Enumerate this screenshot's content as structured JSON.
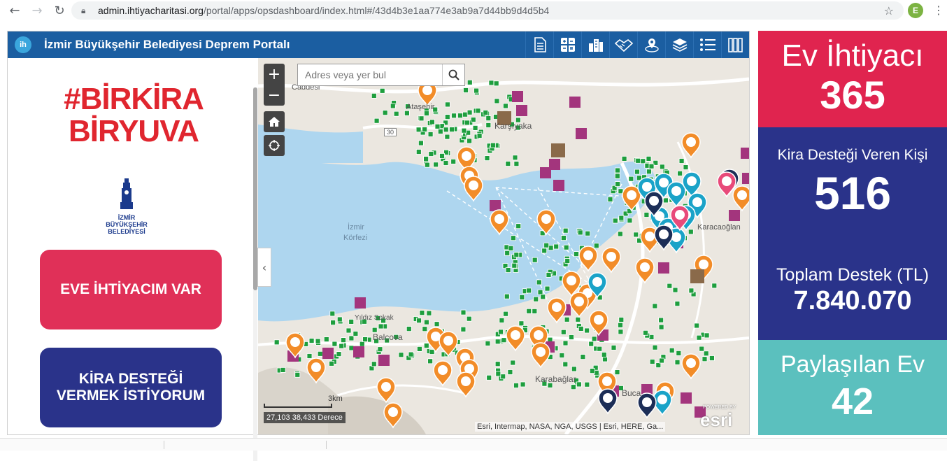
{
  "browser": {
    "url_domain": "admin.ihtiyacharitasi.org",
    "url_path": "/portal/apps/opsdashboard/index.html#/43d4b3e1aa774e3ab9a7d44bb9d4d5b4",
    "profile_initial": "E"
  },
  "header": {
    "logo_text": "ih",
    "title": "İzmir Büyükşehir Belediyesi Deprem Portalı"
  },
  "left_panel": {
    "campaign_line1": "#BİRKİRA",
    "campaign_line2": "BİRYUVA",
    "ibb_line1": "İZMİR",
    "ibb_line2": "BÜYÜKŞEHİR",
    "ibb_line3": "BELEDİYESİ",
    "cta_need_home": "EVE İHTİYACIM VAR",
    "cta_give_support": "KİRA DESTEĞİ VERMEK İSTİYORUM"
  },
  "map": {
    "search_placeholder": "Adres veya yer bul",
    "zoom_in": "+",
    "zoom_out": "−",
    "labels": {
      "karsiyaka": "Karşıyaka",
      "atasehir": "Ataşehir",
      "izmir_korfezi_1": "İzmir",
      "izmir_korfezi_2": "Körfezi",
      "karacaoglan": "Karacaoğlan",
      "yildiz_sokak": "Yıldız Sokak",
      "balcova": "Balçova",
      "karabaglar": "Karabağlar",
      "buca": "Buca",
      "caddesi": "Caddesi",
      "road_30": "30"
    },
    "scale_label": "3km",
    "coordinates": "27,103 38,433 Derece",
    "attribution": "Esri, Intermap, NASA, NGA, USGS | Esri, HERE, Ga...",
    "esri_logo": "esri",
    "esri_powered": "POWERED BY"
  },
  "stats": {
    "need_home_title": "Ev İhtiyacı",
    "need_home_value": "365",
    "rent_support_title": "Kira Desteği Veren Kişi",
    "rent_support_value": "516",
    "total_support_title": "Toplam Destek (TL)",
    "total_support_value": "7.840.070",
    "shared_home_title": "Paylaşılan Ev",
    "shared_home_value": "42"
  },
  "colors": {
    "header_blue": "#1b5ea1",
    "stat_red": "#e0244f",
    "stat_navy": "#2a338a",
    "stat_teal": "#5bc0be",
    "marker_orange": "#f28c28",
    "marker_green": "#1e9e3e",
    "marker_purple": "#a3357d",
    "marker_teal": "#1aa3c8",
    "marker_navy": "#1c2e57",
    "water": "#aed6ef"
  }
}
